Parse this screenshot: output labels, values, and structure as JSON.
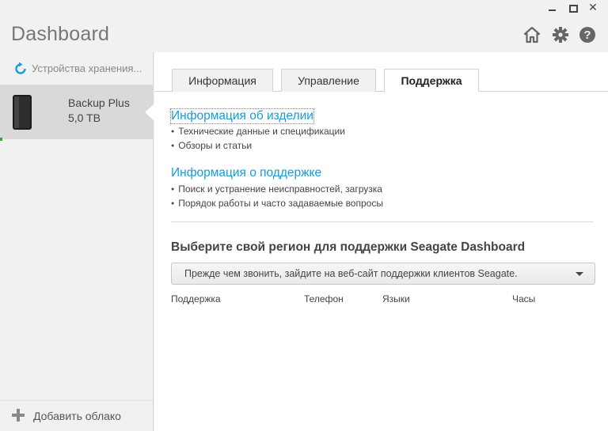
{
  "window": {
    "minimize_label": "",
    "close_label": "✕"
  },
  "header": {
    "title": "Dashboard",
    "icons": [
      "home-icon",
      "gear-icon",
      "help-icon"
    ]
  },
  "sidebar": {
    "header_label": "Устройства хранения...",
    "device": {
      "name": "Backup Plus",
      "size": "5,0 TB"
    },
    "add_cloud_label": "Добавить облако"
  },
  "tabs": [
    {
      "label": "Информация",
      "active": false
    },
    {
      "label": "Управление",
      "active": false
    },
    {
      "label": "Поддержка",
      "active": true
    }
  ],
  "support": {
    "product_info": {
      "title": "Информация об изделии",
      "items": [
        "Технические данные и спецификации",
        "Обзоры и статьи"
      ]
    },
    "support_info": {
      "title": "Информация о поддержке",
      "items": [
        "Поиск и устранение неисправностей, загрузка",
        "Порядок работы и часто задаваемые вопросы"
      ]
    },
    "region_title": "Выберите свой регион для поддержки Seagate Dashboard",
    "region_select_value": "Прежде чем звонить, зайдите на веб-сайт поддержки клиентов Seagate.",
    "columns": [
      "Поддержка",
      "Телефон",
      "Языки",
      "Часы"
    ]
  },
  "colors": {
    "link": "#1a9ad6",
    "selected_device_bg": "#d9d9d9",
    "sidebar_bg": "#f1f1f1"
  }
}
